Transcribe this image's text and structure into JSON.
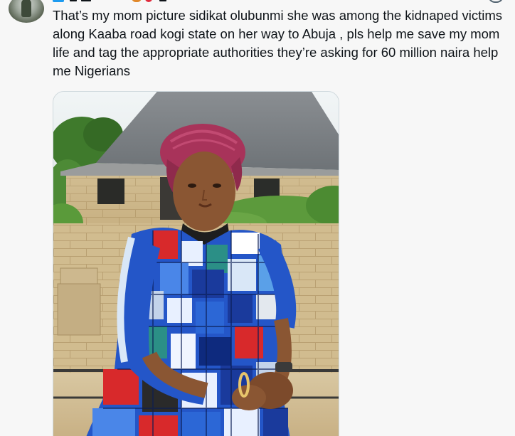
{
  "tweet": {
    "avatar_icon": "avatar-profile-photo",
    "verified_icon": "verified-badge-icon",
    "text": "That’s my mom picture sidikat olubunmi she was among the kidnaped victims along Kaaba road kogi state on her way to Abuja , pls help me save my mom life and tag the appropriate authorities they’re asking for 60 million naira help me Nigerians"
  },
  "media": {
    "type": "photo",
    "description_icon": "photo-of-woman-in-patchwork-dress",
    "colors": {
      "sky": "#eef2f3",
      "roof": "#7f8489",
      "block_wall": "#cbb68a",
      "foliage": "#4f8a35",
      "dress_blue": "#2456c8",
      "dress_red": "#d8292b",
      "skin": "#8a5633",
      "headwrap": "#a8335a"
    }
  },
  "theme": {
    "background": "#f7f7f7",
    "text": "#0f1419",
    "border": "#cfd9de",
    "accent": "#1d9bf0"
  }
}
